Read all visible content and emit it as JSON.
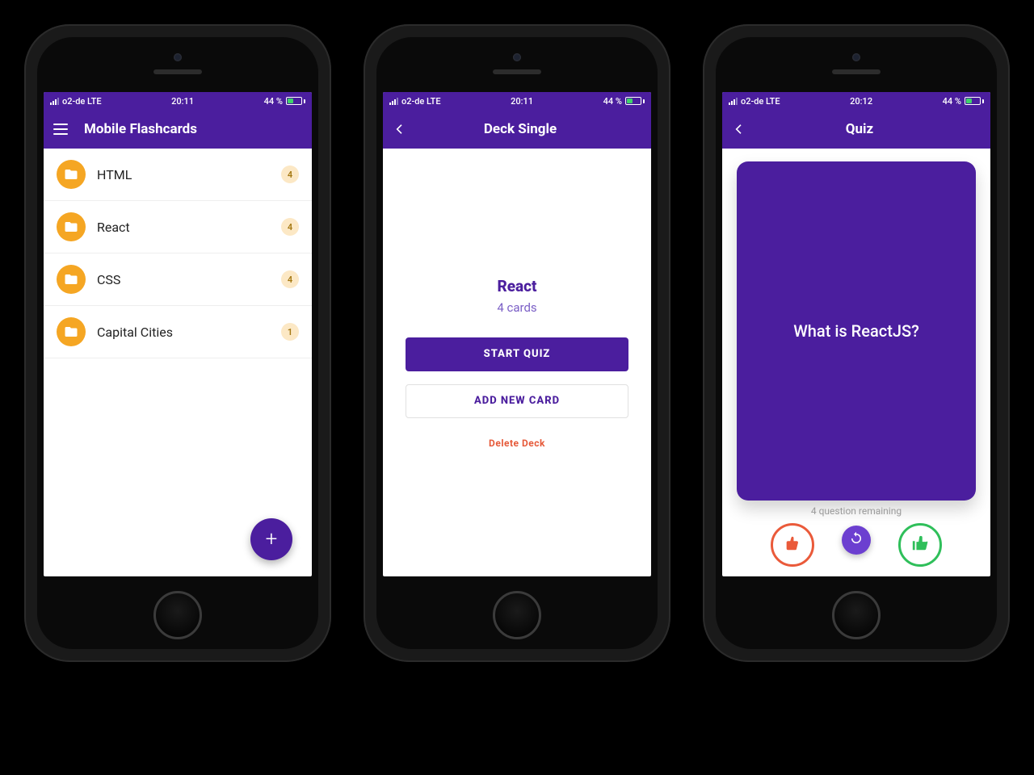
{
  "status": {
    "carrier": "o2-de LTE",
    "time_a": "20:11",
    "time_c": "20:12",
    "battery": "44 %"
  },
  "screen1": {
    "title": "Mobile Flashcards",
    "decks": [
      {
        "name": "HTML",
        "count": "4"
      },
      {
        "name": "React",
        "count": "4"
      },
      {
        "name": "CSS",
        "count": "4"
      },
      {
        "name": "Capital Cities",
        "count": "1"
      }
    ]
  },
  "screen2": {
    "title": "Deck Single",
    "deck_name": "React",
    "card_count": "4 cards",
    "start_quiz": "START QUIZ",
    "add_card": "ADD NEW CARD",
    "delete": "Delete Deck"
  },
  "screen3": {
    "title": "Quiz",
    "question": "What is ReactJS?",
    "remaining": "4 question remaining"
  }
}
